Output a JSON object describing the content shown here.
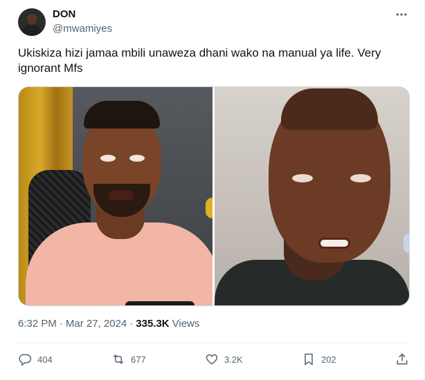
{
  "author": {
    "name": "DON",
    "handle": "@mwamiyes"
  },
  "tweet": {
    "text": "Ukiskiza hizi jamaa mbili unaweza dhani wako na manual ya life. Very ignorant Mfs",
    "time": "6:32 PM",
    "separator": "·",
    "date": "Mar 27, 2024",
    "views_count": "335.3K",
    "views_label": "Views"
  },
  "actions": {
    "replies": "404",
    "reposts": "677",
    "likes": "3.2K",
    "bookmarks": "202"
  },
  "icons": {
    "more": "more-dots-icon",
    "reply": "reply-icon",
    "repost": "repost-icon",
    "like": "heart-icon",
    "bookmark": "bookmark-icon",
    "share": "share-icon"
  },
  "colors": {
    "text_primary": "#0f1419",
    "text_secondary": "#536471",
    "border": "#cfd9de"
  }
}
